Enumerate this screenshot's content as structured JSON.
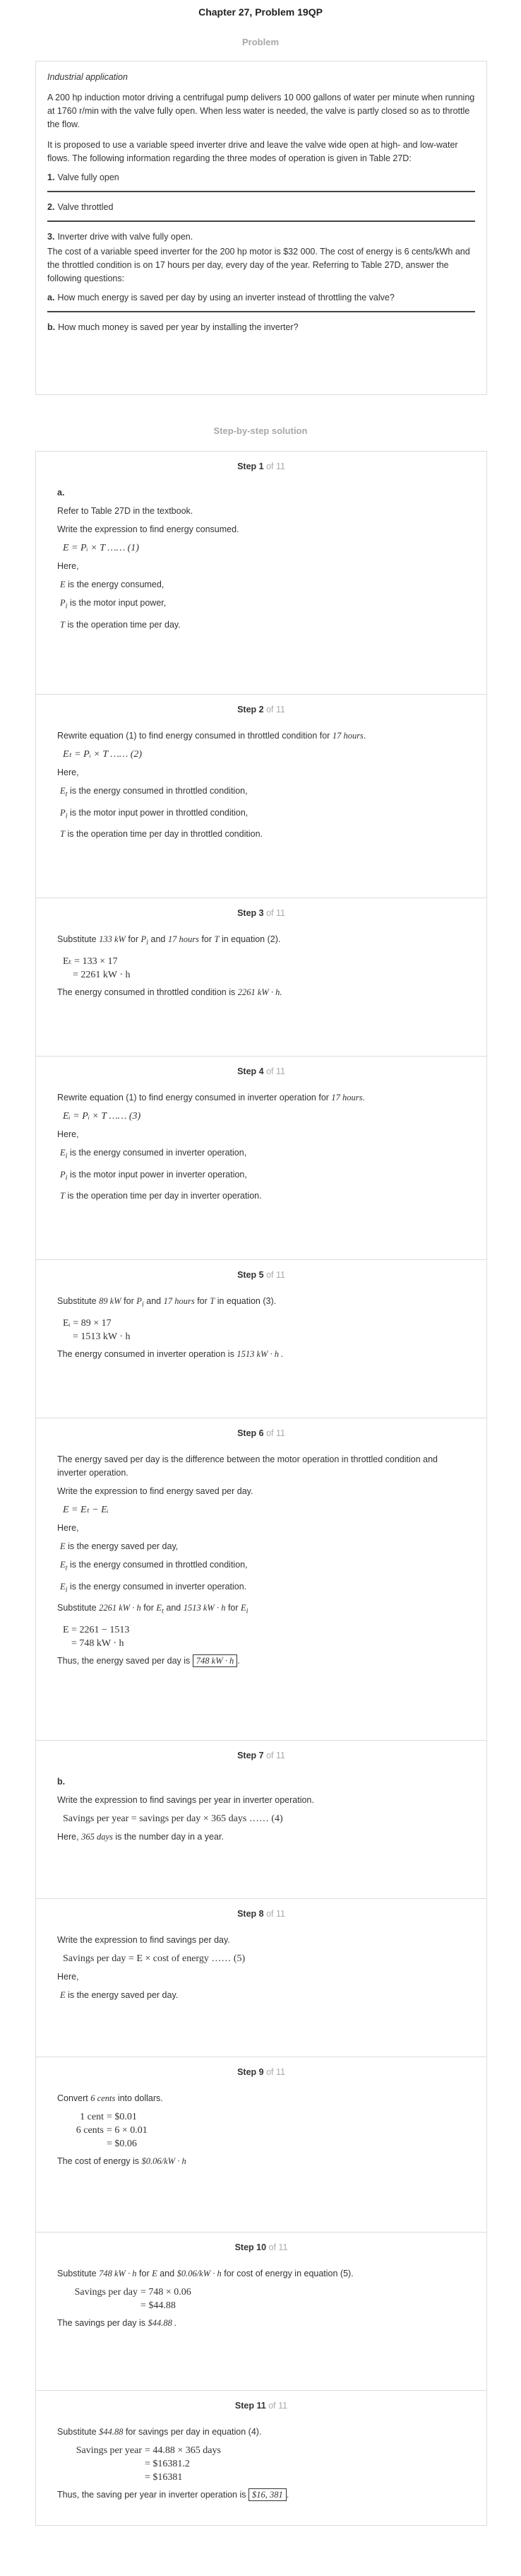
{
  "page_title": "Chapter 27, Problem 19QP",
  "problem_heading": "Problem",
  "problem": {
    "category": "Industrial application",
    "para1": "A 200 hp induction motor driving a centrifugal pump delivers 10 000 gallons of water per minute when running at 1760 r/min with the valve fully open. When less water is needed, the valve is partly closed so as to throttle the flow.",
    "para2": "It is proposed to use a variable speed inverter drive and leave the valve wide open at high- and low-water flows. The following information regarding the three modes of operation is given in Table 27D:",
    "modes": [
      {
        "num": "1.",
        "text": "Valve fully open"
      },
      {
        "num": "2.",
        "text": "Valve throttled"
      },
      {
        "num": "3.",
        "text": "Inverter drive with valve fully open."
      }
    ],
    "para3": "The cost of a variable speed inverter for the 200 hp motor is $32 000. The cost of energy is 6 cents/kWh and the throttled condition is on 17 hours per day, every day of the year. Referring to Table 27D, answer the following questions:",
    "questions": [
      {
        "num": "a.",
        "text": "How much energy is saved per day by using an inverter instead of throttling the valve?"
      },
      {
        "num": "b.",
        "text": "How much money is saved per year by installing the inverter?"
      }
    ]
  },
  "solution_heading": "Step-by-step solution",
  "steps": {
    "s1": {
      "label": "Step 1",
      "of": "of 11",
      "part": "a.",
      "l1": "Refer to Table 27D in the textbook.",
      "l2": "Write the expression to find energy consumed.",
      "eq": "E = Pᵢ × T  …… (1)",
      "here": "Here,",
      "d1": "is the energy consumed,",
      "d2": "is the motor input power,",
      "d3": "is the operation time per day."
    },
    "s2": {
      "label": "Step 2",
      "of": "of 11",
      "l1": "Rewrite equation (1) to find energy consumed in throttled condition for",
      "hours": "17 hours",
      "eq": "Eₜ = Pᵢ × T  …… (2)",
      "here": "Here,",
      "d1": "is the energy consumed in throttled condition,",
      "d2": "is the motor input power in throttled condition,",
      "d3": "is the operation time per day in throttled condition."
    },
    "s3": {
      "label": "Step 3",
      "of": "of 11",
      "l1a": "Substitute",
      "v1": "133 kW",
      "l1b": "for",
      "l1c": "and",
      "v2": "17 hours",
      "l1d": "for",
      "l1e": "in equation (2).",
      "eq1": "Eₜ = 133 × 17",
      "eq2": "= 2261 kW · h",
      "result": "The energy consumed in throttled condition is",
      "rv": "2261 kW · h."
    },
    "s4": {
      "label": "Step 4",
      "of": "of 11",
      "l1": "Rewrite equation (1) to find energy consumed in inverter operation for",
      "hours": "17 hours",
      "eq": "Eᵢ = Pᵢ × T  …… (3)",
      "here": "Here,",
      "d1": "is the energy consumed in inverter operation,",
      "d2": "is the motor input power in inverter operation,",
      "d3": "is the operation time per day in inverter operation."
    },
    "s5": {
      "label": "Step 5",
      "of": "of 11",
      "l1a": "Substitute",
      "v1": "89 kW",
      "l1b": "for",
      "l1c": "and",
      "v2": "17 hours",
      "l1d": "for",
      "l1e": "in equation (3).",
      "eq1": "Eᵢ = 89 × 17",
      "eq2": "= 1513 kW · h",
      "result": "The energy consumed in inverter operation is",
      "rv": "1513 kW · h ."
    },
    "s6": {
      "label": "Step 6",
      "of": "of 11",
      "p1": "The energy saved per day is the difference between the motor operation in throttled condition and inverter operation.",
      "l2": "Write the expression to find energy saved per day.",
      "eq": "E = Eₜ − Eᵢ",
      "here": "Here,",
      "d1": "is the energy saved per day,",
      "d2": "is the energy consumed in throttled condition,",
      "d3": "is the energy consumed in inverter operation.",
      "sub_a": "Substitute",
      "sv1": "2261 kW · h",
      "sub_b": "for",
      "sub_c": "and",
      "sv2": "1513 kW · h",
      "sub_d": "for",
      "eq1": "E = 2261 − 1513",
      "eq2": "= 748 kW · h",
      "result": "Thus, the energy saved per day is",
      "rv": "748 kW · h"
    },
    "s7": {
      "label": "Step 7",
      "of": "of 11",
      "part": "b.",
      "l1": "Write the expression to find savings per year in inverter operation.",
      "eq": "Savings per year = savings per day × 365 days  …… (4)",
      "here_a": "Here,",
      "days": "365 days",
      "here_b": "is the number day in a year."
    },
    "s8": {
      "label": "Step 8",
      "of": "of 11",
      "l1": "Write the expression to find savings per day.",
      "eq": "Savings per day = E × cost of energy  …… (5)",
      "here": "Here,",
      "d1": "is the energy saved per day."
    },
    "s9": {
      "label": "Step 9",
      "of": "of 11",
      "l1a": "Convert",
      "v1": "6 cents",
      "l1b": "into dollars.",
      "r1a": "1 cent",
      "r1b": "= $0.01",
      "r2a": "6 cents",
      "r2b": "= 6 × 0.01",
      "r3b": "= $0.06",
      "result": "The cost of energy is",
      "rv": "$0.06/kW · h"
    },
    "s10": {
      "label": "Step 10",
      "of": "of 11",
      "l1a": "Substitute",
      "v1": "748 kW · h",
      "l1b": "for",
      "l1c": "and",
      "v2": "$0.06/kW · h",
      "l1d": "for cost of energy in equation (5).",
      "r1a": "Savings per day",
      "r1b": "= 748 × 0.06",
      "r2b": "= $44.88",
      "result": "The savings per day is",
      "rv": "$44.88 ."
    },
    "s11": {
      "label": "Step 11",
      "of": "of 11",
      "l1a": "Substitute",
      "v1": "$44.88",
      "l1b": "for savings per day in equation (4).",
      "r1a": "Savings per year",
      "r1b": "= 44.88 × 365 days",
      "r2b": "= $16381.2",
      "r3b": "= $16381",
      "result": "Thus, the saving per year in inverter operation is",
      "rv": "$16, 381"
    }
  }
}
